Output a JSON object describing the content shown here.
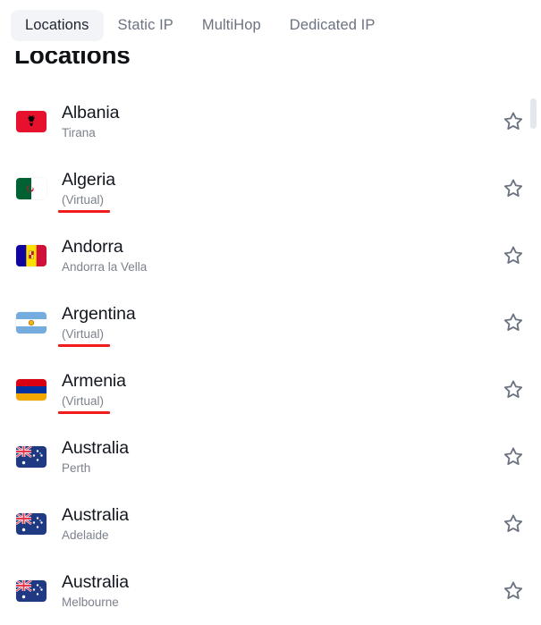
{
  "tabs": [
    {
      "label": "Locations",
      "active": true
    },
    {
      "label": "Static IP",
      "active": false
    },
    {
      "label": "MultiHop",
      "active": false
    },
    {
      "label": "Dedicated IP",
      "active": false
    }
  ],
  "page": {
    "title": "Locations"
  },
  "colors": {
    "virtual_underline": "#f21b1b",
    "active_tab_bg": "#f3f4f8",
    "tab_inactive_text": "#6b7280",
    "country_text": "#13171f",
    "subtitle_text": "#7c828c",
    "star_stroke": "#6b7280",
    "scrollbar_thumb": "#e4e7ee"
  },
  "locations": [
    {
      "country": "Albania",
      "subtitle": "Tirana",
      "virtual": false,
      "flag": "albania",
      "favorite": false,
      "favorite_icon": "star-outline-icon"
    },
    {
      "country": "Algeria",
      "subtitle": "(Virtual)",
      "virtual": true,
      "flag": "algeria",
      "favorite": false,
      "favorite_icon": "star-outline-icon"
    },
    {
      "country": "Andorra",
      "subtitle": "Andorra la Vella",
      "virtual": false,
      "flag": "andorra",
      "favorite": false,
      "favorite_icon": "star-outline-icon"
    },
    {
      "country": "Argentina",
      "subtitle": "(Virtual)",
      "virtual": true,
      "flag": "argentina",
      "favorite": false,
      "favorite_icon": "star-outline-icon"
    },
    {
      "country": "Armenia",
      "subtitle": "(Virtual)",
      "virtual": true,
      "flag": "armenia",
      "favorite": false,
      "favorite_icon": "star-outline-icon"
    },
    {
      "country": "Australia",
      "subtitle": "Perth",
      "virtual": false,
      "flag": "australia",
      "favorite": false,
      "favorite_icon": "star-outline-icon"
    },
    {
      "country": "Australia",
      "subtitle": "Adelaide",
      "virtual": false,
      "flag": "australia",
      "favorite": false,
      "favorite_icon": "star-outline-icon"
    },
    {
      "country": "Australia",
      "subtitle": "Melbourne",
      "virtual": false,
      "flag": "australia",
      "favorite": false,
      "favorite_icon": "star-outline-icon"
    }
  ],
  "scrollbar": {
    "name": "vertical-scrollbar"
  }
}
